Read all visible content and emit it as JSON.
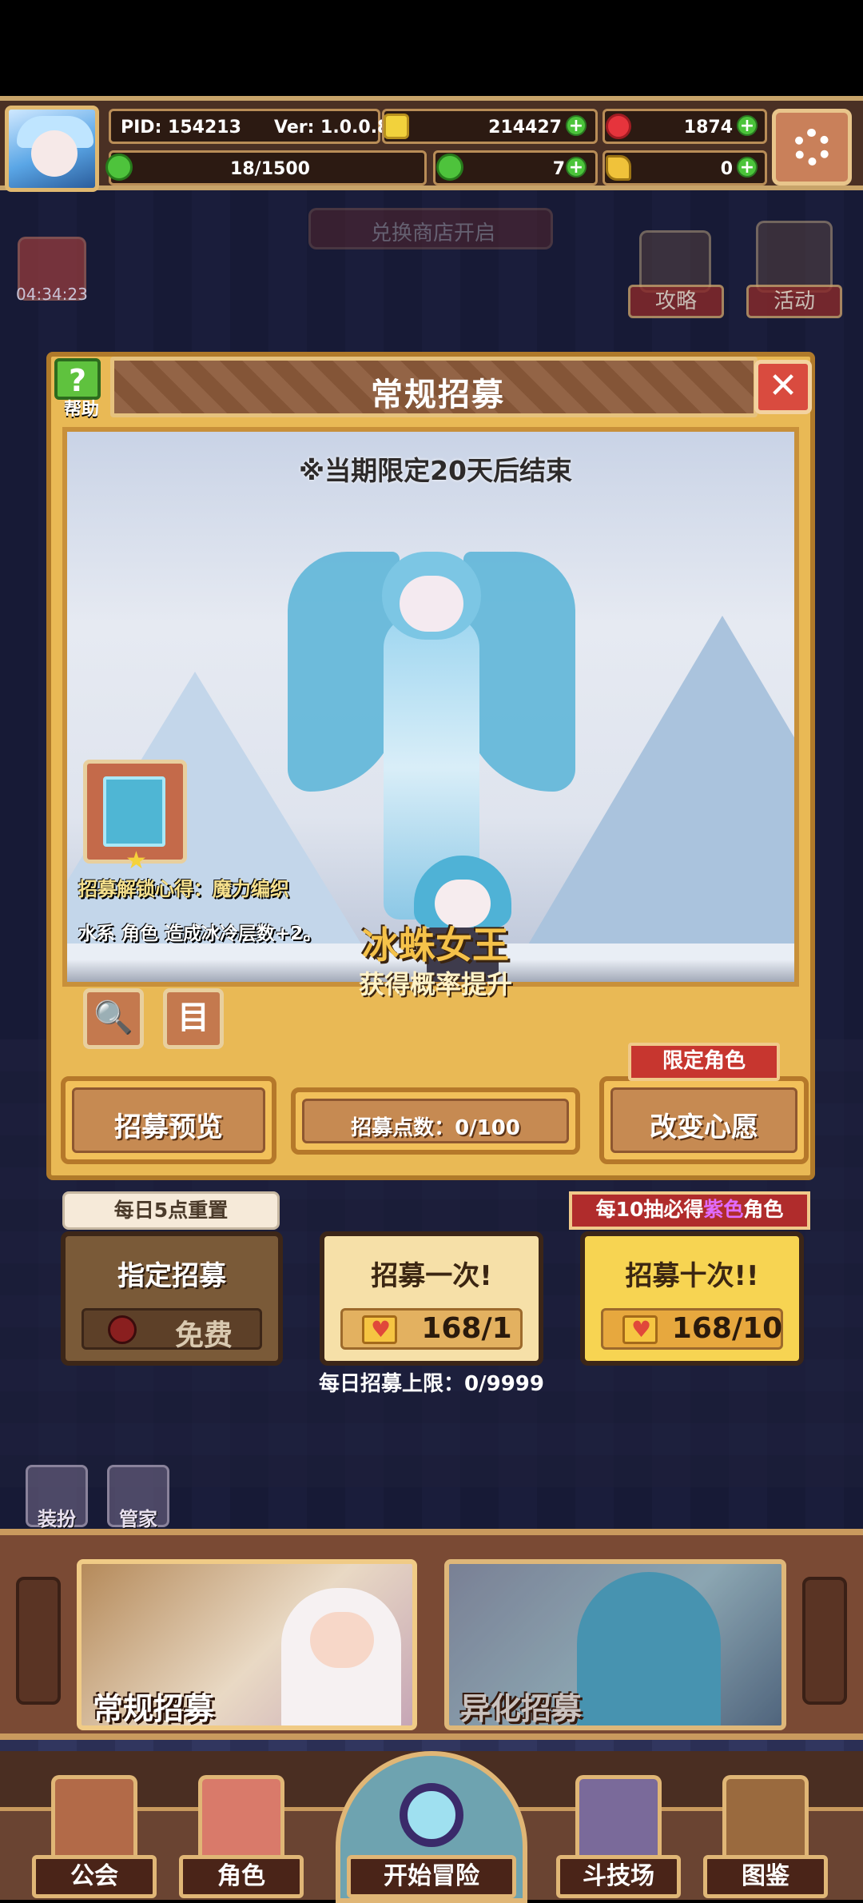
{
  "hud": {
    "pid": "PID: 154213",
    "version": "Ver: 1.0.0.8",
    "gold": "214427",
    "gems": "1874",
    "stamina": "18/1500",
    "clover": "7",
    "keys": "0",
    "plus": "+"
  },
  "scene": {
    "shop_banner": "兑换商店开启",
    "timer": "04:34:23",
    "guide": "攻略",
    "event": "活动",
    "dress": "装扮",
    "butler": "管家"
  },
  "panel": {
    "title": "常规招募",
    "help": "帮助",
    "help_mark": "?",
    "close": "✕",
    "limited_notice": "※当期限定20天后结束",
    "unlock_label": "招募解锁心得：",
    "unlock_value": "魔力编织",
    "effect": "水系 角色 造成冰冷层数+2。",
    "hero_name": "冰蛛女王",
    "rate_up": "获得概率提升",
    "search_icon": "🔍",
    "list_icon": "目",
    "preview": "招募预览",
    "points": "招募点数：0/100",
    "wish_tag": "限定角色",
    "wish": "改变心愿"
  },
  "recruit": {
    "reset_tag": "每日5点重置",
    "must_tag_prefix": "每10抽必得",
    "must_tag_color": "紫色",
    "must_tag_suffix": "角色",
    "designated_title": "指定招募",
    "designated_cost": "免费",
    "once_title": "招募一次!",
    "once_cost": "168/1",
    "ten_title": "招募十次!!",
    "ten_cost": "168/10",
    "daily_limit": "每日招募上限：0/9999"
  },
  "pools": {
    "normal": "常规招募",
    "alien": "异化招募"
  },
  "nav": {
    "guild": "公会",
    "character": "角色",
    "adventure": "开始冒险",
    "arena": "斗技场",
    "codex": "图鉴"
  },
  "colors": {
    "accent_gold": "#e9b955",
    "panel_border": "#b07a2a",
    "title_bar": "#8c5a3a",
    "close_red": "#d94b3f",
    "help_green": "#5fc23e",
    "ten_pull_yellow": "#f7d452",
    "purple_text": "#e06cff"
  }
}
